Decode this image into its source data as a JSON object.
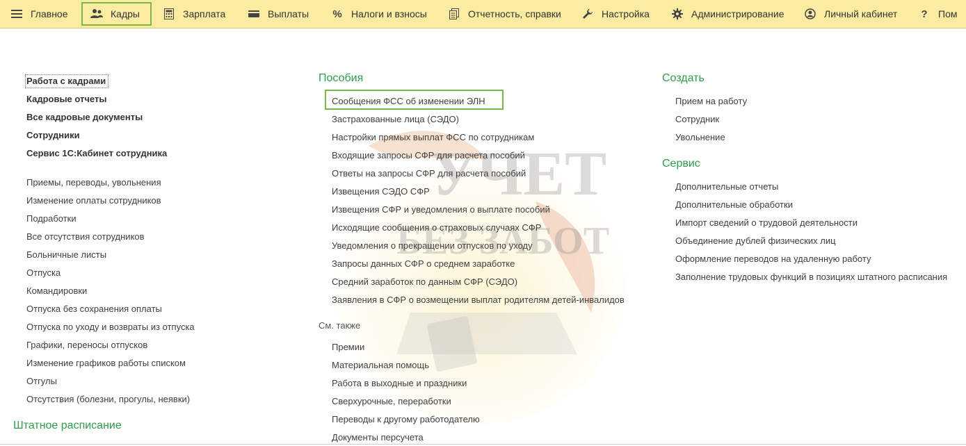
{
  "menu": {
    "items": [
      {
        "label": "Главное",
        "icon": "hamburger-icon"
      },
      {
        "label": "Кадры",
        "icon": "people-icon"
      },
      {
        "label": "Зарплата",
        "icon": "calculator-icon"
      },
      {
        "label": "Выплаты",
        "icon": "wallet-icon"
      },
      {
        "label": "Налоги и взносы",
        "icon": "percent-icon"
      },
      {
        "label": "Отчетность, справки",
        "icon": "reports-icon"
      },
      {
        "label": "Настройка",
        "icon": "wrench-icon"
      },
      {
        "label": "Администрирование",
        "icon": "gear-icon"
      },
      {
        "label": "Личный кабинет",
        "icon": "user-circle-icon"
      },
      {
        "label": "Пом",
        "icon": "question-icon"
      }
    ]
  },
  "left": {
    "bold_links": [
      "Работа с кадрами",
      "Кадровые отчеты",
      "Все кадровые документы",
      "Сотрудники",
      "Сервис 1С:Кабинет сотрудника"
    ],
    "links": [
      "Приемы, переводы, увольнения",
      "Изменение оплаты сотрудников",
      "Подработки",
      "Все отсутствия сотрудников",
      "Больничные листы",
      "Отпуска",
      "Командировки",
      "Отпуска без сохранения оплаты",
      "Отпуска по уходу и возвраты из отпуска",
      "Графики, переносы отпусков",
      "Изменение графиков работы списком",
      "Отгулы",
      "Отсутствия (болезни, прогулы, неявки)"
    ],
    "staff_title": "Штатное расписание"
  },
  "middle": {
    "title": "Пособия",
    "links": [
      "Сообщения ФСС об изменении ЭЛН",
      "Застрахованные лица (СЭДО)",
      "Настройки прямых выплат ФСС по сотрудникам",
      "Входящие запросы СФР для расчета пособий",
      "Ответы на запросы СФР для расчета пособий",
      "Извещения СЭДО СФР",
      "Извещения СФР и уведомления о выплате пособий",
      "Исходящие сообщения о страховых случаях СФР",
      "Уведомления о прекращении отпусков по уходу",
      "Запросы данных СФР о среднем заработке",
      "Средний заработок по данным СФР (СЭДО)",
      "Заявления в СФР о возмещении выплат родителям детей-инвалидов"
    ],
    "see_also_title": "См. также",
    "see_also_links": [
      "Премии",
      "Материальная помощь",
      "Работа в выходные и праздники",
      "Сверхурочные, переработки",
      "Переводы к другому работодателю",
      "Документы персучета"
    ]
  },
  "right": {
    "create_title": "Создать",
    "create_links": [
      "Прием на работу",
      "Сотрудник",
      "Увольнение"
    ],
    "service_title": "Сервис",
    "service_links": [
      "Дополнительные отчеты",
      "Дополнительные обработки",
      "Импорт сведений о трудовой деятельности",
      "Объединение дублей физических лиц",
      "Оформление переводов на удаленную работу",
      "Заполнение трудовых функций в позициях штатного расписания"
    ]
  },
  "watermark": {
    "line1": "УЧЕТ",
    "line2": "БЕЗ ЗАБОТ"
  },
  "colors": {
    "menu_bg": "#fbeca2",
    "section_green": "#2e9c4b",
    "highlight_green": "#7ab648"
  }
}
